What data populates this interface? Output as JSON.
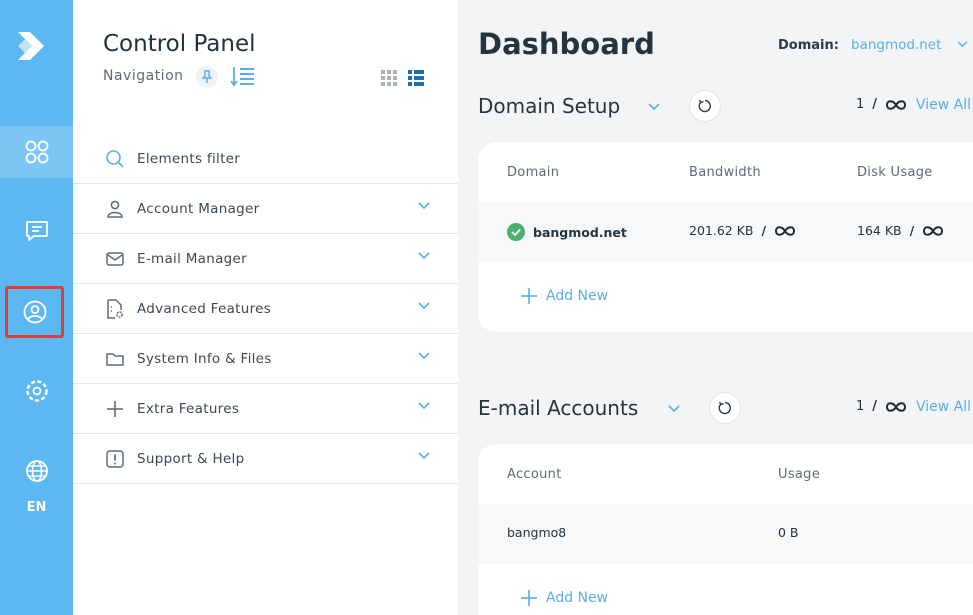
{
  "rail": {
    "lang": "EN",
    "icons": [
      "logo-icon",
      "dashboard-icon",
      "messages-icon",
      "user-icon",
      "settings-icon",
      "globe-icon"
    ]
  },
  "nav": {
    "title": "Control Panel",
    "subtitle": "Navigation",
    "filter_placeholder": "Elements filter",
    "items": [
      {
        "label": "Elements filter",
        "icon": "search-icon"
      },
      {
        "label": "Account Manager",
        "icon": "user-icon"
      },
      {
        "label": "E-mail Manager",
        "icon": "mail-icon"
      },
      {
        "label": "Advanced Features",
        "icon": "file-gear-icon"
      },
      {
        "label": "System Info & Files",
        "icon": "folder-icon"
      },
      {
        "label": "Extra Features",
        "icon": "plus-icon"
      },
      {
        "label": "Support & Help",
        "icon": "alert-icon"
      }
    ]
  },
  "main": {
    "title": "Dashboard",
    "domain_label": "Domain:",
    "domain_value": "bangmod.net",
    "domain_setup": {
      "title": "Domain Setup",
      "count": "1",
      "slash": "/",
      "view_all": "View All",
      "columns": [
        "Domain",
        "Bandwidth",
        "Disk Usage"
      ],
      "row": {
        "domain": "bangmod.net",
        "bandwidth": "201.62 KB",
        "bw_sep": "/",
        "disk": "164 KB",
        "disk_sep": "/"
      },
      "add_new": "Add New"
    },
    "email_accounts": {
      "title": "E-mail Accounts",
      "count": "1",
      "slash": "/",
      "view_all": "View All",
      "columns": [
        "Account",
        "Usage"
      ],
      "row": {
        "account": "bangmo8",
        "usage": "0 B"
      },
      "add_new": "Add New"
    }
  },
  "colors": {
    "rail": "#5cb8f2",
    "accent": "#5aaee8",
    "success": "#4caf6e",
    "highlight": "#e53935"
  }
}
